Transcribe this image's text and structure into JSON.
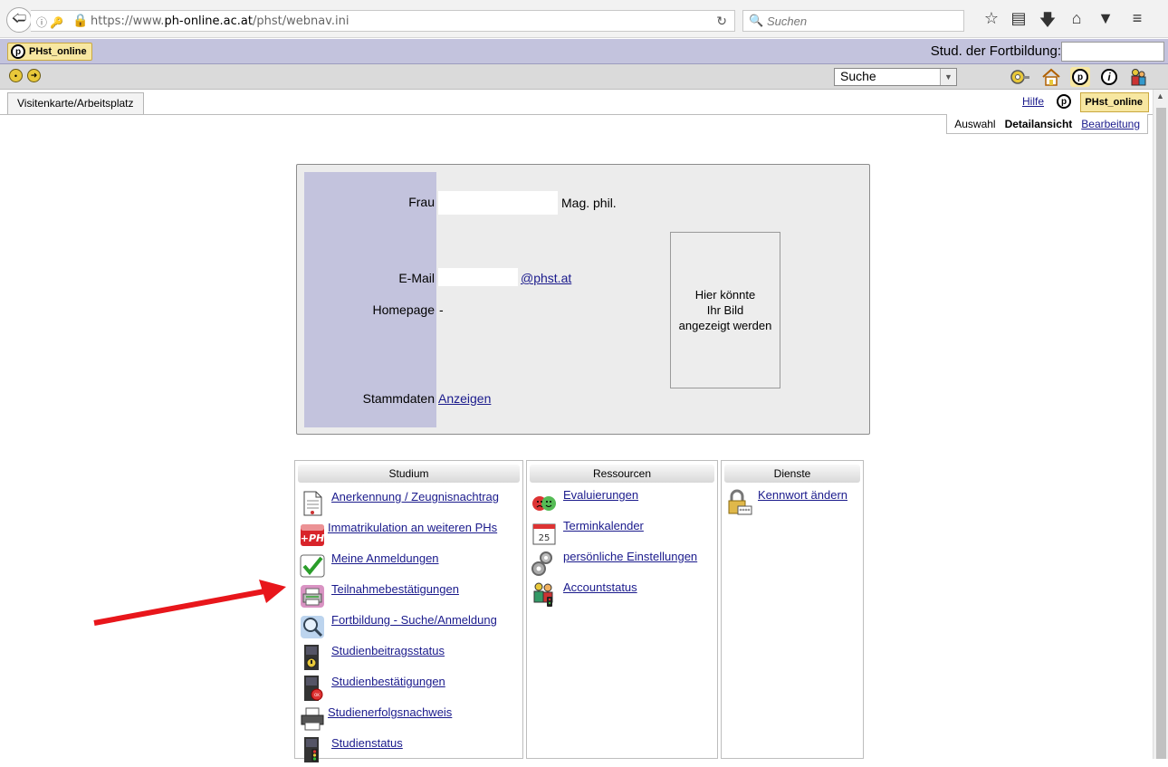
{
  "browser": {
    "url_prefix": "https://www.",
    "url_host": "ph-online.ac.at",
    "url_path": "/phst/webnav.ini",
    "search_placeholder": "Suchen"
  },
  "header": {
    "brand": "PHst_online",
    "stud_label": "Stud. der Fortbildung:",
    "stud_value": ""
  },
  "toolbar": {
    "search_select": "Suche"
  },
  "tabs": {
    "active": "Visitenkarte/Arbeitsplatz",
    "help": "Hilfe",
    "brand": "PHst_online"
  },
  "view_modes": {
    "auswahl": "Auswahl",
    "detail": "Detailansicht",
    "edit": "Bearbeitung"
  },
  "card": {
    "salutation_label": "Frau",
    "title": "Mag. phil.",
    "email_label": "E-Mail",
    "email_domain": "@phst.at",
    "homepage_label": "Homepage",
    "homepage_value": "-",
    "stammdaten_label": "Stammdaten",
    "stammdaten_link": "Anzeigen",
    "photo_placeholder_1": "Hier könnte",
    "photo_placeholder_2": "Ihr Bild",
    "photo_placeholder_3": "angezeigt werden"
  },
  "panels": {
    "studium": {
      "title": "Studium",
      "items": [
        {
          "label": "Anerkennung / Zeugnisnachtrag",
          "icon": "document-icon"
        },
        {
          "label": "Immatrikulation an weiteren PHs",
          "icon": "plus-ph-icon"
        },
        {
          "label": "Meine Anmeldungen",
          "icon": "checkmark-icon"
        },
        {
          "label": "Teilnahmebestätigungen",
          "icon": "printer-pink-icon"
        },
        {
          "label": "Fortbildung - Suche/Anmeldung",
          "icon": "magnifier-icon"
        },
        {
          "label": "Studienbeitragsstatus",
          "icon": "fee-status-icon"
        },
        {
          "label": "Studienbestätigungen",
          "icon": "certificate-icon"
        },
        {
          "label": "Studienerfolgsnachweis",
          "icon": "printer-icon"
        },
        {
          "label": "Studienstatus",
          "icon": "traffic-light-icon"
        }
      ]
    },
    "ressourcen": {
      "title": "Ressourcen",
      "items": [
        {
          "label": "Evaluierungen",
          "icon": "smileys-icon"
        },
        {
          "label": "Terminkalender",
          "icon": "calendar-icon",
          "day": "25"
        },
        {
          "label": "persönliche Einstellungen",
          "icon": "gears-icon"
        },
        {
          "label": "Accountstatus",
          "icon": "account-status-icon"
        }
      ]
    },
    "dienste": {
      "title": "Dienste",
      "items": [
        {
          "label": "Kennwort ändern",
          "icon": "lock-icon"
        }
      ]
    }
  },
  "colors": {
    "accent_bar": "#c3c3dd",
    "link": "#1a1a8c",
    "arrow": "#e8161b"
  }
}
